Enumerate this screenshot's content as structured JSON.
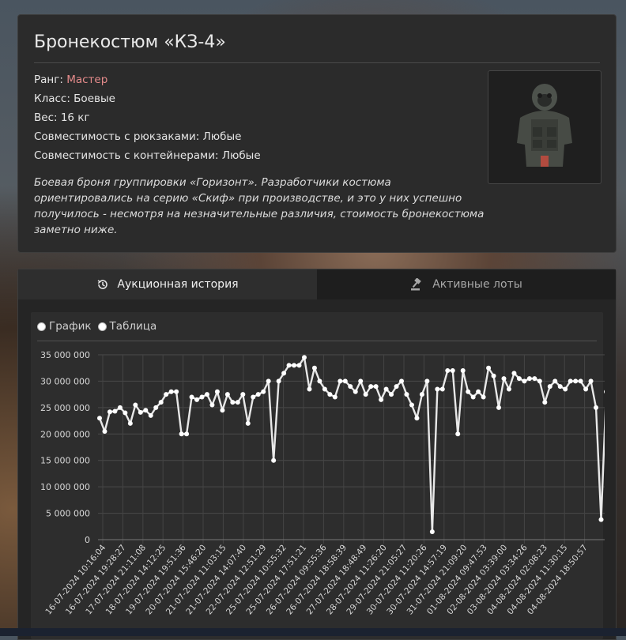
{
  "item": {
    "title": "Бронекостюм «КЗ-4»",
    "rank_label": "Ранг: ",
    "rank_value": "Мастер",
    "class_text": "Класс: Боевые",
    "weight_text": "Вес: 16 кг",
    "backpack_text": "Совместимость с рюкзаками: Любые",
    "container_text": "Совместимость с контейнерами: Любые",
    "description": "Боевая броня группировки «Горизонт». Разработчики костюма ориентировались на серию «Скиф» при производстве, и это у них успешно получилось - несмотря на незначительные различия, стоимость бронекостюма заметно ниже.",
    "rank_color": "#e58b8b"
  },
  "tabs": [
    {
      "label": "Аукционная история",
      "icon": "history-icon",
      "active": true
    },
    {
      "label": "Активные лоты",
      "icon": "gavel-icon",
      "active": false
    }
  ],
  "view_toggle": [
    {
      "label": "График",
      "selected": false
    },
    {
      "label": "Таблица",
      "selected": false
    }
  ],
  "chart_data": {
    "type": "line",
    "title": "",
    "xlabel": "",
    "ylabel": "",
    "ylim": [
      0,
      35000000
    ],
    "yticks": [
      "0",
      "5 000 000",
      "10 000 000",
      "15 000 000",
      "20 000 000",
      "25 000 000",
      "30 000 000",
      "35 000 000"
    ],
    "xtick_labels": [
      "16-07-2024 10:16:04",
      "16-07-2024 19:28:27",
      "17-07-2024 21:11:08",
      "18-07-2024 14:12:25",
      "19-07-2024 19:51:36",
      "20-07-2024 15:46:20",
      "21-07-2024 11:03:15",
      "21-07-2024 14:07:40",
      "22-07-2024 12:51:29",
      "25-07-2024 10:55:32",
      "25-07-2024 17:51:21",
      "26-07-2024 09:55:36",
      "26-07-2024 18:58:39",
      "27-07-2024 18:48:49",
      "28-07-2024 11:26:20",
      "29-07-2024 21:05:27",
      "30-07-2024 11:20:26",
      "30-07-2024 14:57:19",
      "31-07-2024 21:09:20",
      "01-08-2024 09:47:53",
      "02-08-2024 03:39:00",
      "03-08-2024 03:34:26",
      "04-08-2024 02:08:23",
      "04-08-2024 11:30:15",
      "04-08-2024 18:50:57"
    ],
    "series": [
      {
        "color": "#e8e8e8",
        "values": [
          23000000,
          20500000,
          24200000,
          24300000,
          25000000,
          24000000,
          22000000,
          25500000,
          24100000,
          24500000,
          23500000,
          25000000,
          26000000,
          27500000,
          28000000,
          28000000,
          20000000,
          20000000,
          27000000,
          26500000,
          27000000,
          27500000,
          25500000,
          28000000,
          24500000,
          27500000,
          26000000,
          26000000,
          27500000,
          22000000,
          27000000,
          27500000,
          28000000,
          30000000,
          15000000,
          30000000,
          31500000,
          33000000,
          33000000,
          33000000,
          34500000,
          28500000,
          32500000,
          30000000,
          28500000,
          27500000,
          27000000,
          30000000,
          30000000,
          29000000,
          28000000,
          30000000,
          27500000,
          29000000,
          29000000,
          26500000,
          28500000,
          27500000,
          29000000,
          30000000,
          27500000,
          25500000,
          23000000,
          27500000,
          30000000,
          1500000,
          28500000,
          28500000,
          32000000,
          32000000,
          20000000,
          32000000,
          28000000,
          27000000,
          28000000,
          27000000,
          32500000,
          31000000,
          25000000,
          30500000,
          28500000,
          31500000,
          30500000,
          30000000,
          30500000,
          30500000,
          30000000,
          26000000,
          29000000,
          30000000,
          29000000,
          28500000,
          30000000,
          30000000,
          30000000,
          28500000,
          30000000,
          25000000,
          3800000,
          28000000
        ]
      }
    ]
  }
}
